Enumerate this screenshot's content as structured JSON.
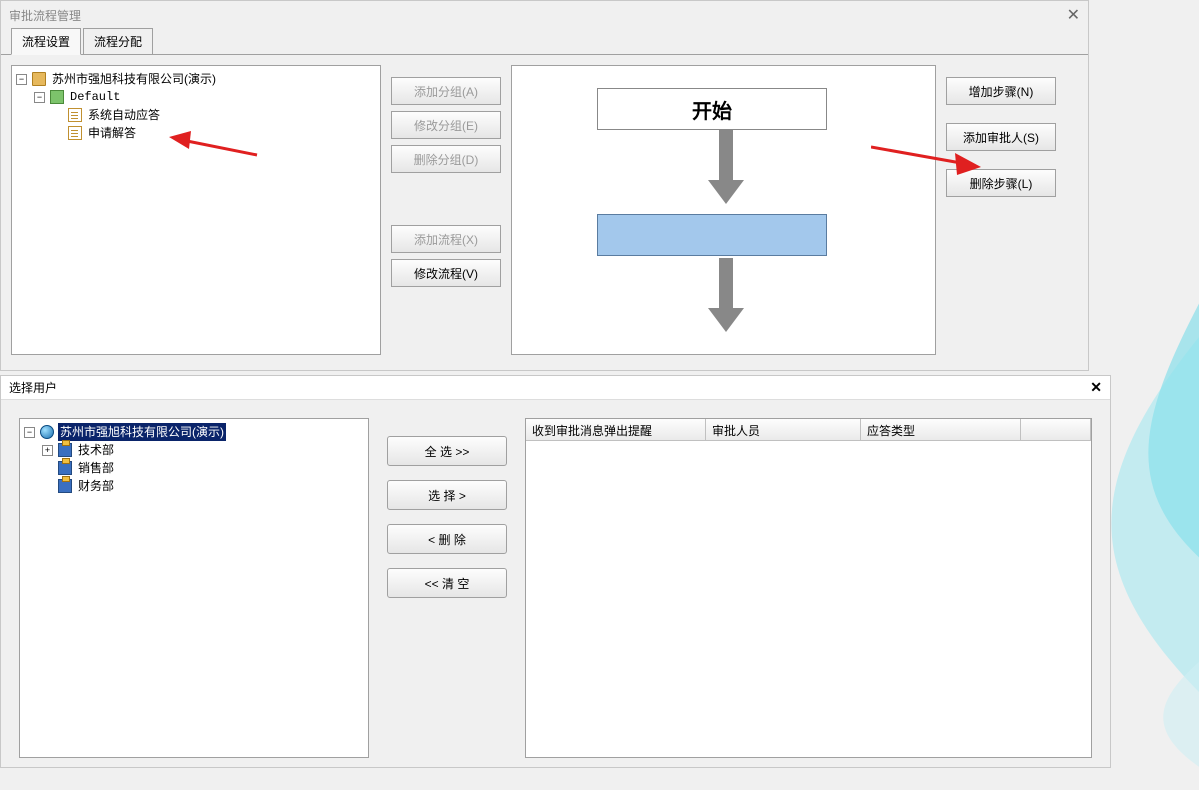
{
  "win1": {
    "title": "审批流程管理",
    "tabs": {
      "settings": "流程设置",
      "assign": "流程分配"
    },
    "tree": {
      "root": "苏州市强旭科技有限公司(演示)",
      "default": "Default",
      "autoreply": "系统自动应答",
      "apply": "申请解答"
    },
    "buttons": {
      "add_group": "添加分组(A)",
      "edit_group": "修改分组(E)",
      "del_group": "删除分组(D)",
      "add_flow": "添加流程(X)",
      "edit_flow": "修改流程(V)"
    },
    "flow": {
      "start": "开始"
    },
    "actions": {
      "add_step": "增加步骤(N)",
      "add_approver": "添加审批人(S)",
      "del_step": "删除步骤(L)"
    }
  },
  "win2": {
    "title": "选择用户",
    "tree": {
      "root": "苏州市强旭科技有限公司(演示)",
      "tech": "技术部",
      "sales": "销售部",
      "finance": "财务部"
    },
    "buttons": {
      "select_all": "全  选  >>",
      "select": "选    择  >",
      "remove": "<  删    除",
      "clear": "<<  清    空"
    },
    "grid": {
      "c1": "收到审批消息弹出提醒",
      "c2": "审批人员",
      "c3": "应答类型"
    }
  }
}
